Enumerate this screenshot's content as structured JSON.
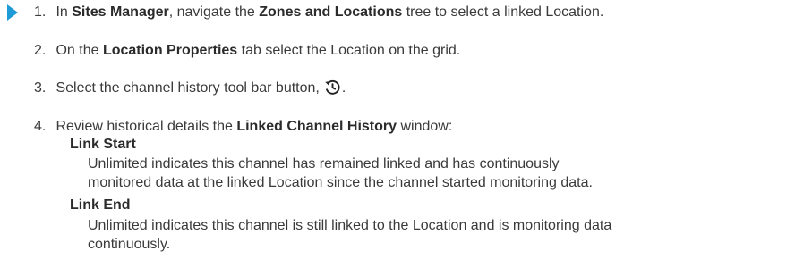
{
  "steps": [
    {
      "number": "1.",
      "t1": "In ",
      "b1": "Sites Manager",
      "t2": ", navigate the ",
      "b2": "Zones and Locations",
      "t3": " tree to select a linked Location."
    },
    {
      "number": "2.",
      "t1": "On the ",
      "b1": "Location Properties",
      "t2": " tab select the Location on the grid."
    },
    {
      "number": "3.",
      "t1": "Select the channel history tool bar button,",
      "t2": ".",
      "icon": "history-icon"
    },
    {
      "number": "4.",
      "t1": "Review historical details the ",
      "b1": "Linked Channel History",
      "t2": " window:"
    }
  ],
  "definitions": [
    {
      "term": "Link Start",
      "lines": [
        "Unlimited indicates this channel has remained linked and has continuously",
        "monitored data at the linked Location since the channel started monitoring data."
      ]
    },
    {
      "term": "Link End",
      "lines": [
        "Unlimited indicates this channel is still linked to the Location and is monitoring data",
        "continuously."
      ]
    }
  ],
  "colors": {
    "arrow": "#1e9ad6",
    "text": "#3a3a3a"
  },
  "icons": {
    "step_marker": "play-arrow-icon",
    "history": "history-icon"
  }
}
